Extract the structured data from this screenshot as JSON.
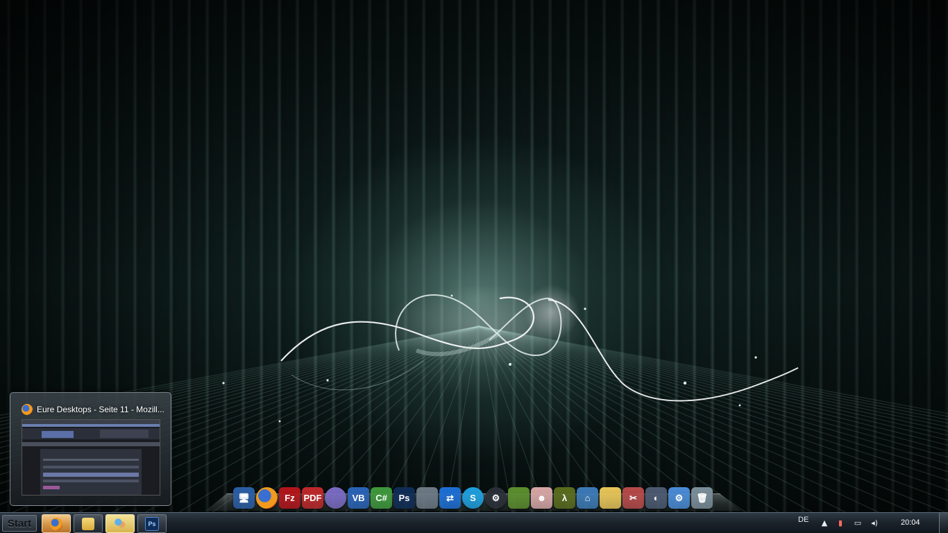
{
  "desktop": {
    "wallpaper": "dark teal light-beam wallpaper with white infinity ribbon"
  },
  "dock": {
    "icons": [
      {
        "name": "computer-icon",
        "glyph": "🖥",
        "bg": "#2b5fa6"
      },
      {
        "name": "firefox-icon",
        "glyph": "",
        "bg": "#e0771d"
      },
      {
        "name": "filezilla-icon",
        "glyph": "Fz",
        "bg": "#b5151b"
      },
      {
        "name": "pdf-icon",
        "glyph": "PDF",
        "bg": "#c0282a"
      },
      {
        "name": "eclipse-icon",
        "glyph": "",
        "bg": "#7b6bc4"
      },
      {
        "name": "visual-basic-icon",
        "glyph": "VB",
        "bg": "#2a64b8"
      },
      {
        "name": "csharp-icon",
        "glyph": "C#",
        "bg": "#3e9a3c"
      },
      {
        "name": "photoshop-icon",
        "glyph": "Ps",
        "bg": "#0f2d57"
      },
      {
        "name": "virtualbox-icon",
        "glyph": "",
        "bg": "#6d7a86"
      },
      {
        "name": "teamviewer-icon",
        "glyph": "⇄",
        "bg": "#1d6fd6"
      },
      {
        "name": "skype-icon",
        "glyph": "S",
        "bg": "#1ea0e0"
      },
      {
        "name": "steam-icon",
        "glyph": "⚙",
        "bg": "#2a2f38"
      },
      {
        "name": "minecraft-icon",
        "glyph": "",
        "bg": "#5c8f2d"
      },
      {
        "name": "binding-of-isaac-icon",
        "glyph": "☻",
        "bg": "#d9a7a7"
      },
      {
        "name": "java-icon",
        "glyph": "λ",
        "bg": "#5a6d1d"
      },
      {
        "name": "network-icon",
        "glyph": "⌂",
        "bg": "#3c7bb8"
      },
      {
        "name": "folder-icon",
        "glyph": "",
        "bg": "#e9c658"
      },
      {
        "name": "tools-icon",
        "glyph": "✂",
        "bg": "#b84a4a"
      },
      {
        "name": "rocketdock-icon",
        "glyph": "◐",
        "bg": "#4c5a72"
      },
      {
        "name": "settings-gear-icon",
        "glyph": "⚙",
        "bg": "#4a8cd8"
      },
      {
        "name": "recycle-bin-icon",
        "glyph": "🗑",
        "bg": "#7b8f9b"
      }
    ]
  },
  "thumbnail": {
    "title": "Eure Desktops - Seite 11 - Mozill..."
  },
  "taskbar": {
    "start_label": "Start",
    "buttons": [
      {
        "name": "taskbar-firefox",
        "active": true
      },
      {
        "name": "taskbar-explorer",
        "active": false
      },
      {
        "name": "taskbar-contacts",
        "active": false
      },
      {
        "name": "taskbar-photoshop",
        "active": false
      }
    ],
    "tray": {
      "language": "DE",
      "clock": "20:04"
    }
  }
}
